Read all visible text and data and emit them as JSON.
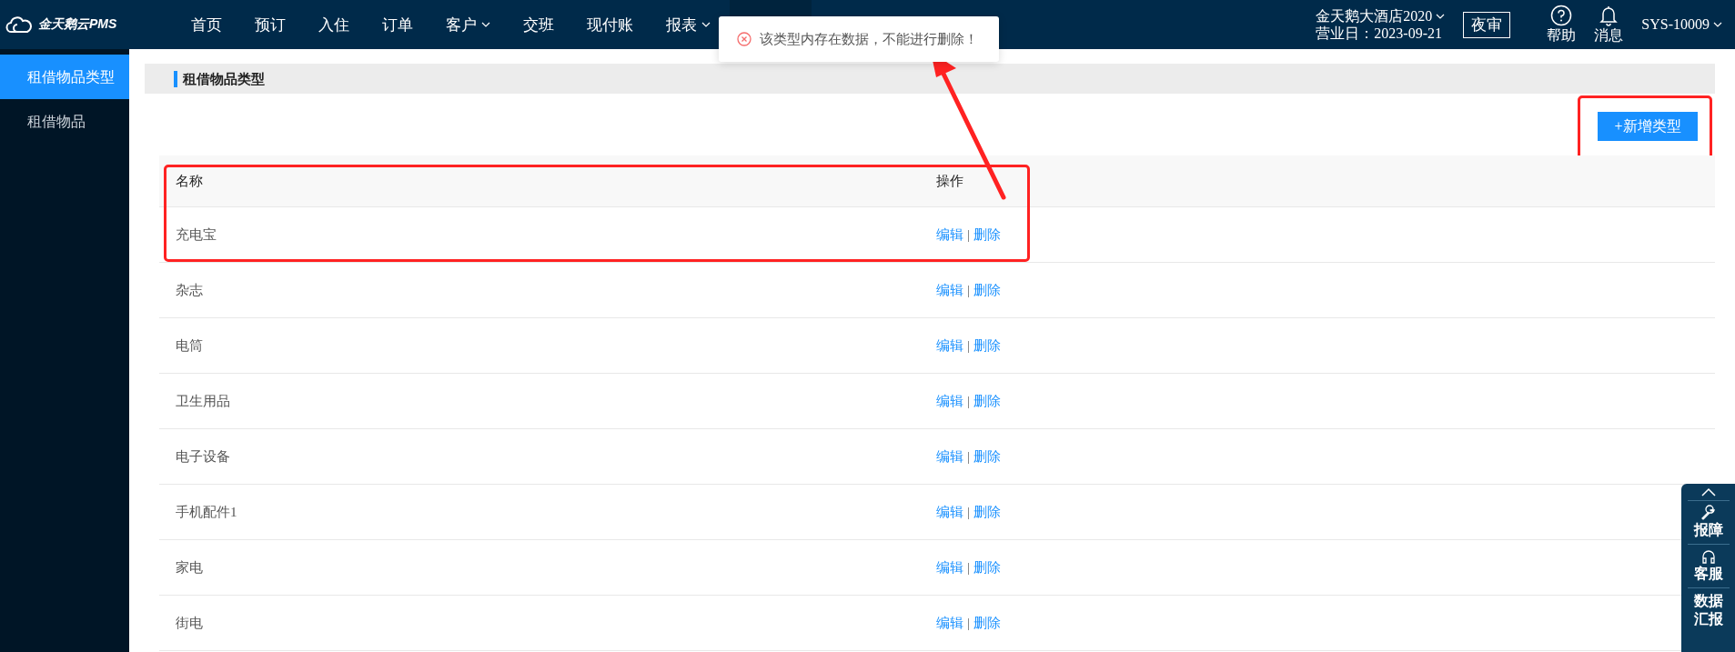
{
  "logo": {
    "text": "金天鹅云PMS"
  },
  "nav": [
    {
      "label": "首页",
      "dropdown": false,
      "selected": false
    },
    {
      "label": "预订",
      "dropdown": false,
      "selected": false
    },
    {
      "label": "入住",
      "dropdown": false,
      "selected": false
    },
    {
      "label": "订单",
      "dropdown": false,
      "selected": false
    },
    {
      "label": "客户",
      "dropdown": true,
      "selected": false
    },
    {
      "label": "交班",
      "dropdown": false,
      "selected": false
    },
    {
      "label": "现付账",
      "dropdown": false,
      "selected": false
    },
    {
      "label": "报表",
      "dropdown": true,
      "selected": false
    },
    {
      "dropdown": false,
      "selected": true
    }
  ],
  "hotel": {
    "name": "金天鹅大酒店2020",
    "business_day": "营业日：2023-09-21"
  },
  "night_audit_button": "夜审",
  "header_icons": [
    {
      "kind": "help",
      "label": "帮助"
    },
    {
      "kind": "bell",
      "label": "消息"
    }
  ],
  "user": "SYS-10009",
  "sidebar": {
    "items": [
      {
        "label": "租借物品类型",
        "selected": true
      },
      {
        "label": "租借物品",
        "selected": false
      }
    ]
  },
  "panel_title": "租借物品类型",
  "add_button": {
    "label": "+新增类型",
    "highlighted": true
  },
  "table": {
    "columns": [
      "名称",
      "操作"
    ],
    "rows": [
      {
        "name": "充电宝",
        "actions": [
          "编辑",
          "删除"
        ],
        "separator": "|",
        "highlighted": true
      },
      {
        "name": "杂志",
        "actions": [
          "编辑",
          "删除"
        ],
        "separator": "|",
        "highlighted": false
      },
      {
        "name": "电筒",
        "actions": [
          "编辑",
          "删除"
        ],
        "separator": "|",
        "highlighted": false
      },
      {
        "name": "卫生用品",
        "actions": [
          "编辑",
          "删除"
        ],
        "separator": "|",
        "highlighted": false
      },
      {
        "name": "电子设备",
        "actions": [
          "编辑",
          "删除"
        ],
        "separator": "|",
        "highlighted": false
      },
      {
        "name": "手机配件1",
        "actions": [
          "编辑",
          "删除"
        ],
        "separator": "|",
        "highlighted": false
      },
      {
        "name": "家电",
        "actions": [
          "编辑",
          "删除"
        ],
        "separator": "|",
        "highlighted": false
      },
      {
        "name": "街电",
        "actions": [
          "编辑",
          "删除"
        ],
        "separator": "|",
        "highlighted": false
      }
    ]
  },
  "toast": {
    "kind": "error",
    "message": "该类型内存在数据，不能进行删除！"
  },
  "annotation_arrow": true,
  "float_bar": {
    "items": [
      {
        "kind": "up"
      },
      {
        "kind": "wrench",
        "label": "报障"
      },
      {
        "kind": "headset",
        "label": "客服"
      },
      {
        "kind": "text",
        "label": "数据汇报"
      }
    ]
  }
}
